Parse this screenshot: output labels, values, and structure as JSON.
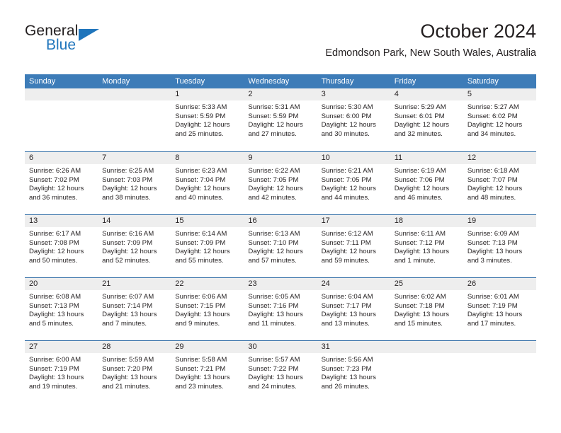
{
  "brand": {
    "word_one": "General",
    "word_two": "Blue",
    "accent_color": "#1f75bc",
    "triangle_icon": "triangle-icon"
  },
  "header": {
    "title": "October 2024",
    "subtitle": "Edmondson Park, New South Wales, Australia"
  },
  "theme": {
    "header_blue": "#3d7cb8",
    "row_divider_blue": "#2f6ca6",
    "date_band_gray": "#eeeeee",
    "text_color": "#231f20"
  },
  "weekdays": [
    "Sunday",
    "Monday",
    "Tuesday",
    "Wednesday",
    "Thursday",
    "Friday",
    "Saturday"
  ],
  "weeks": [
    [
      {
        "date": "",
        "sunrise": "",
        "sunset": "",
        "daylight": ""
      },
      {
        "date": "",
        "sunrise": "",
        "sunset": "",
        "daylight": ""
      },
      {
        "date": "1",
        "sunrise": "Sunrise: 5:33 AM",
        "sunset": "Sunset: 5:59 PM",
        "daylight": "Daylight: 12 hours and 25 minutes."
      },
      {
        "date": "2",
        "sunrise": "Sunrise: 5:31 AM",
        "sunset": "Sunset: 5:59 PM",
        "daylight": "Daylight: 12 hours and 27 minutes."
      },
      {
        "date": "3",
        "sunrise": "Sunrise: 5:30 AM",
        "sunset": "Sunset: 6:00 PM",
        "daylight": "Daylight: 12 hours and 30 minutes."
      },
      {
        "date": "4",
        "sunrise": "Sunrise: 5:29 AM",
        "sunset": "Sunset: 6:01 PM",
        "daylight": "Daylight: 12 hours and 32 minutes."
      },
      {
        "date": "5",
        "sunrise": "Sunrise: 5:27 AM",
        "sunset": "Sunset: 6:02 PM",
        "daylight": "Daylight: 12 hours and 34 minutes."
      }
    ],
    [
      {
        "date": "6",
        "sunrise": "Sunrise: 6:26 AM",
        "sunset": "Sunset: 7:02 PM",
        "daylight": "Daylight: 12 hours and 36 minutes."
      },
      {
        "date": "7",
        "sunrise": "Sunrise: 6:25 AM",
        "sunset": "Sunset: 7:03 PM",
        "daylight": "Daylight: 12 hours and 38 minutes."
      },
      {
        "date": "8",
        "sunrise": "Sunrise: 6:23 AM",
        "sunset": "Sunset: 7:04 PM",
        "daylight": "Daylight: 12 hours and 40 minutes."
      },
      {
        "date": "9",
        "sunrise": "Sunrise: 6:22 AM",
        "sunset": "Sunset: 7:05 PM",
        "daylight": "Daylight: 12 hours and 42 minutes."
      },
      {
        "date": "10",
        "sunrise": "Sunrise: 6:21 AM",
        "sunset": "Sunset: 7:05 PM",
        "daylight": "Daylight: 12 hours and 44 minutes."
      },
      {
        "date": "11",
        "sunrise": "Sunrise: 6:19 AM",
        "sunset": "Sunset: 7:06 PM",
        "daylight": "Daylight: 12 hours and 46 minutes."
      },
      {
        "date": "12",
        "sunrise": "Sunrise: 6:18 AM",
        "sunset": "Sunset: 7:07 PM",
        "daylight": "Daylight: 12 hours and 48 minutes."
      }
    ],
    [
      {
        "date": "13",
        "sunrise": "Sunrise: 6:17 AM",
        "sunset": "Sunset: 7:08 PM",
        "daylight": "Daylight: 12 hours and 50 minutes."
      },
      {
        "date": "14",
        "sunrise": "Sunrise: 6:16 AM",
        "sunset": "Sunset: 7:09 PM",
        "daylight": "Daylight: 12 hours and 52 minutes."
      },
      {
        "date": "15",
        "sunrise": "Sunrise: 6:14 AM",
        "sunset": "Sunset: 7:09 PM",
        "daylight": "Daylight: 12 hours and 55 minutes."
      },
      {
        "date": "16",
        "sunrise": "Sunrise: 6:13 AM",
        "sunset": "Sunset: 7:10 PM",
        "daylight": "Daylight: 12 hours and 57 minutes."
      },
      {
        "date": "17",
        "sunrise": "Sunrise: 6:12 AM",
        "sunset": "Sunset: 7:11 PM",
        "daylight": "Daylight: 12 hours and 59 minutes."
      },
      {
        "date": "18",
        "sunrise": "Sunrise: 6:11 AM",
        "sunset": "Sunset: 7:12 PM",
        "daylight": "Daylight: 13 hours and 1 minute."
      },
      {
        "date": "19",
        "sunrise": "Sunrise: 6:09 AM",
        "sunset": "Sunset: 7:13 PM",
        "daylight": "Daylight: 13 hours and 3 minutes."
      }
    ],
    [
      {
        "date": "20",
        "sunrise": "Sunrise: 6:08 AM",
        "sunset": "Sunset: 7:13 PM",
        "daylight": "Daylight: 13 hours and 5 minutes."
      },
      {
        "date": "21",
        "sunrise": "Sunrise: 6:07 AM",
        "sunset": "Sunset: 7:14 PM",
        "daylight": "Daylight: 13 hours and 7 minutes."
      },
      {
        "date": "22",
        "sunrise": "Sunrise: 6:06 AM",
        "sunset": "Sunset: 7:15 PM",
        "daylight": "Daylight: 13 hours and 9 minutes."
      },
      {
        "date": "23",
        "sunrise": "Sunrise: 6:05 AM",
        "sunset": "Sunset: 7:16 PM",
        "daylight": "Daylight: 13 hours and 11 minutes."
      },
      {
        "date": "24",
        "sunrise": "Sunrise: 6:04 AM",
        "sunset": "Sunset: 7:17 PM",
        "daylight": "Daylight: 13 hours and 13 minutes."
      },
      {
        "date": "25",
        "sunrise": "Sunrise: 6:02 AM",
        "sunset": "Sunset: 7:18 PM",
        "daylight": "Daylight: 13 hours and 15 minutes."
      },
      {
        "date": "26",
        "sunrise": "Sunrise: 6:01 AM",
        "sunset": "Sunset: 7:19 PM",
        "daylight": "Daylight: 13 hours and 17 minutes."
      }
    ],
    [
      {
        "date": "27",
        "sunrise": "Sunrise: 6:00 AM",
        "sunset": "Sunset: 7:19 PM",
        "daylight": "Daylight: 13 hours and 19 minutes."
      },
      {
        "date": "28",
        "sunrise": "Sunrise: 5:59 AM",
        "sunset": "Sunset: 7:20 PM",
        "daylight": "Daylight: 13 hours and 21 minutes."
      },
      {
        "date": "29",
        "sunrise": "Sunrise: 5:58 AM",
        "sunset": "Sunset: 7:21 PM",
        "daylight": "Daylight: 13 hours and 23 minutes."
      },
      {
        "date": "30",
        "sunrise": "Sunrise: 5:57 AM",
        "sunset": "Sunset: 7:22 PM",
        "daylight": "Daylight: 13 hours and 24 minutes."
      },
      {
        "date": "31",
        "sunrise": "Sunrise: 5:56 AM",
        "sunset": "Sunset: 7:23 PM",
        "daylight": "Daylight: 13 hours and 26 minutes."
      },
      {
        "date": "",
        "sunrise": "",
        "sunset": "",
        "daylight": ""
      },
      {
        "date": "",
        "sunrise": "",
        "sunset": "",
        "daylight": ""
      }
    ]
  ]
}
